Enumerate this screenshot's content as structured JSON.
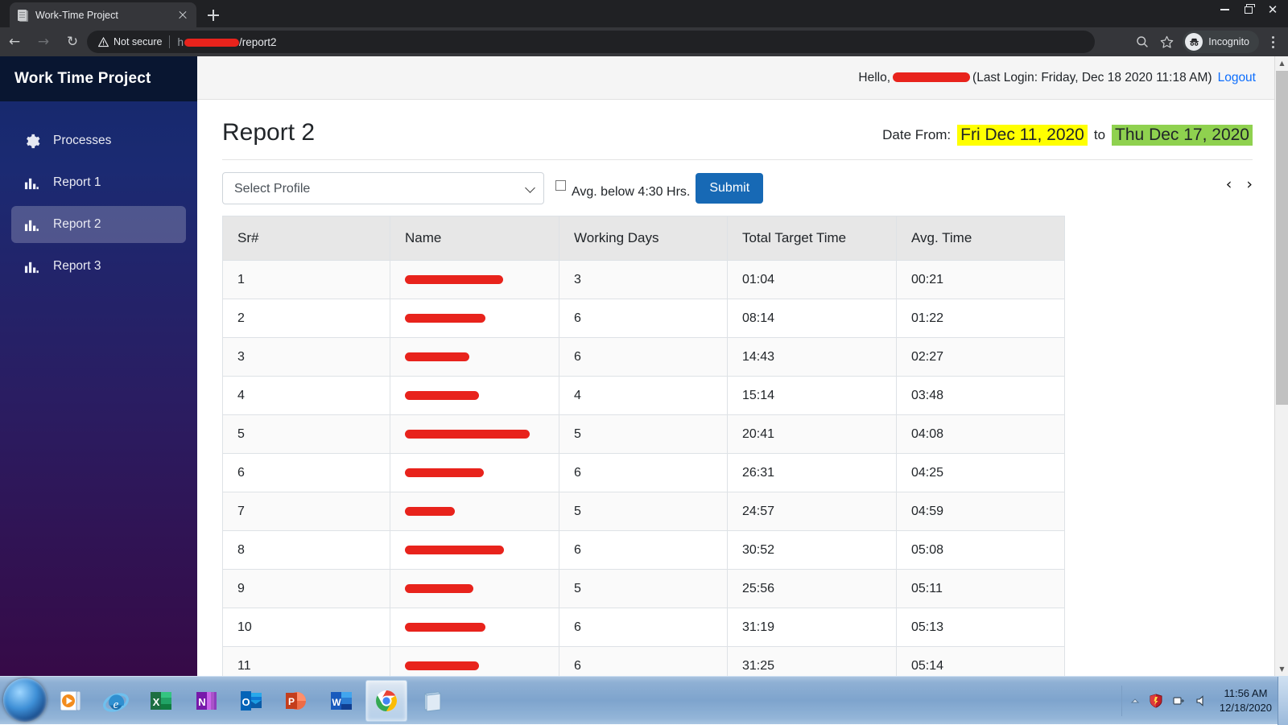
{
  "browser": {
    "tab": {
      "title": "Work-Time Project",
      "favicon": "page-icon"
    },
    "new_tab_tooltip": "New tab",
    "security_label": "Not secure",
    "url_suffix": "/report2",
    "url_prefix": "h",
    "profile_label": "Incognito",
    "window_controls": {
      "minimize": "minimize",
      "maximize": "maximize",
      "close": "close"
    }
  },
  "sidebar": {
    "brand": "Work Time Project",
    "items": [
      {
        "label": "Processes",
        "icon": "gear-icon",
        "active": false
      },
      {
        "label": "Report 1",
        "icon": "bar-chart-icon",
        "active": false
      },
      {
        "label": "Report 2",
        "icon": "bar-chart-icon",
        "active": true
      },
      {
        "label": "Report 3",
        "icon": "bar-chart-icon",
        "active": false
      }
    ]
  },
  "topbar": {
    "greeting": "Hello,",
    "last_login": "(Last Login: Friday, Dec 18 2020 11:18 AM)",
    "logout": "Logout"
  },
  "page": {
    "title": "Report 2",
    "date_from_label": "Date From:",
    "date_from": "Fri Dec 11, 2020",
    "date_to_word": "to",
    "date_to": "Thu Dec 17, 2020",
    "date_from_highlight": "#ffff00",
    "date_to_highlight": "#8fd14f"
  },
  "filters": {
    "profile_selected": "Select Profile",
    "profile_options": [
      "Select Profile"
    ],
    "avg_checkbox_label": "Avg. below 4:30 Hrs.",
    "avg_checkbox_checked": false,
    "submit_label": "Submit",
    "submit_color": "#1769b5",
    "prev_label": "‹",
    "next_label": "›"
  },
  "table": {
    "columns": [
      "Sr#",
      "Name",
      "Working Days",
      "Total Target Time",
      "Avg. Time"
    ],
    "rows": [
      {
        "sr": "1",
        "name": "",
        "name_redacted_width": 122,
        "working_days": "3",
        "total_target_time": "01:04",
        "avg_time": "00:21"
      },
      {
        "sr": "2",
        "name": "",
        "name_redacted_width": 100,
        "working_days": "6",
        "total_target_time": "08:14",
        "avg_time": "01:22"
      },
      {
        "sr": "3",
        "name": "",
        "name_redacted_width": 80,
        "working_days": "6",
        "total_target_time": "14:43",
        "avg_time": "02:27"
      },
      {
        "sr": "4",
        "name": "",
        "name_redacted_width": 92,
        "working_days": "4",
        "total_target_time": "15:14",
        "avg_time": "03:48"
      },
      {
        "sr": "5",
        "name": "",
        "name_redacted_width": 155,
        "working_days": "5",
        "total_target_time": "20:41",
        "avg_time": "04:08"
      },
      {
        "sr": "6",
        "name": "",
        "name_redacted_width": 98,
        "working_days": "6",
        "total_target_time": "26:31",
        "avg_time": "04:25"
      },
      {
        "sr": "7",
        "name": "",
        "name_redacted_width": 62,
        "working_days": "5",
        "total_target_time": "24:57",
        "avg_time": "04:59"
      },
      {
        "sr": "8",
        "name": "",
        "name_redacted_width": 123,
        "working_days": "6",
        "total_target_time": "30:52",
        "avg_time": "05:08"
      },
      {
        "sr": "9",
        "name": "",
        "name_redacted_width": 85,
        "working_days": "5",
        "total_target_time": "25:56",
        "avg_time": "05:11"
      },
      {
        "sr": "10",
        "name": "",
        "name_redacted_width": 100,
        "working_days": "6",
        "total_target_time": "31:19",
        "avg_time": "05:13"
      },
      {
        "sr": "11",
        "name": "",
        "name_redacted_width": 92,
        "working_days": "6",
        "total_target_time": "31:25",
        "avg_time": "05:14"
      }
    ]
  },
  "taskbar": {
    "start_tooltip": "Start",
    "apps": [
      {
        "name": "windows-media-player-icon"
      },
      {
        "name": "internet-explorer-icon"
      },
      {
        "name": "excel-icon"
      },
      {
        "name": "onenote-icon"
      },
      {
        "name": "outlook-icon"
      },
      {
        "name": "powerpoint-icon"
      },
      {
        "name": "word-icon"
      },
      {
        "name": "chrome-icon"
      },
      {
        "name": "notepad-icon"
      }
    ],
    "tray": [
      "show-hidden-icons-arrow",
      "security-shield-icon",
      "network-icon",
      "volume-icon"
    ],
    "time": "11:56 AM",
    "date": "12/18/2020"
  }
}
